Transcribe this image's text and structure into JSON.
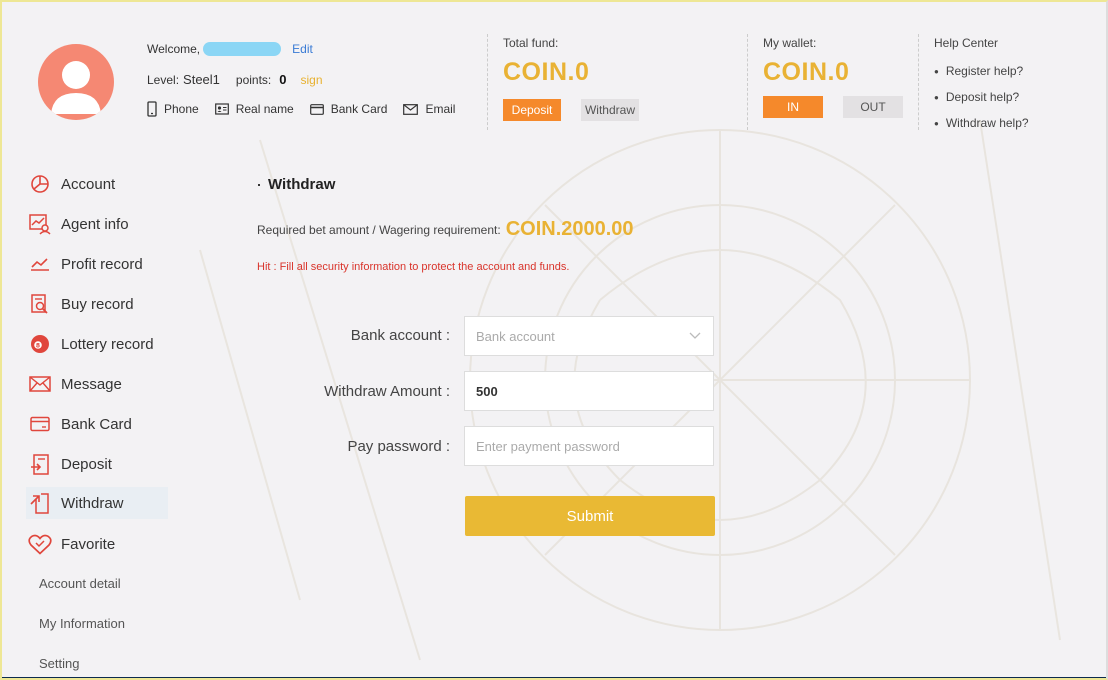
{
  "header": {
    "welcome_label": "Welcome,",
    "edit_label": "Edit",
    "level_label": "Level:",
    "level_value": "Steel1",
    "points_label": "points:",
    "points_value": "0",
    "sign_label": "sign",
    "verify_items": [
      "Phone",
      "Real name",
      "Bank Card",
      "Email"
    ],
    "total_fund_label": "Total fund:",
    "total_fund_value": "COIN.0",
    "deposit_button": "Deposit",
    "withdraw_button": "Withdraw",
    "wallet_label": "My wallet:",
    "wallet_value": "COIN.0",
    "in_button": "IN",
    "out_button": "OUT",
    "help_title": "Help Center",
    "help_items": [
      "Register help?",
      "Deposit help?",
      "Withdraw help?"
    ]
  },
  "sidebar": {
    "items": [
      {
        "label": "Account",
        "icon": "pie-chart-icon"
      },
      {
        "label": "Agent info",
        "icon": "agent-chart-icon"
      },
      {
        "label": "Profit record",
        "icon": "trend-line-icon"
      },
      {
        "label": "Buy record",
        "icon": "document-search-icon"
      },
      {
        "label": "Lottery record",
        "icon": "lottery-ball-icon"
      },
      {
        "label": "Message",
        "icon": "envelope-icon"
      },
      {
        "label": "Bank Card",
        "icon": "bank-card-icon"
      },
      {
        "label": "Deposit",
        "icon": "deposit-icon"
      },
      {
        "label": "Withdraw",
        "icon": "withdraw-icon",
        "active": true
      },
      {
        "label": "Favorite",
        "icon": "heart-icon"
      }
    ],
    "sub_items": [
      "Account detail",
      "My Information",
      "Setting"
    ]
  },
  "main": {
    "title": "Withdraw",
    "requirement_label": "Required bet amount / Wagering requirement:",
    "requirement_value": "COIN.2000.00",
    "hint": "Hit : Fill all security information to protect the account and funds.",
    "bank_account_label": "Bank account :",
    "bank_account_placeholder": "Bank account",
    "amount_label": "Withdraw Amount :",
    "amount_value": "500",
    "password_label": "Pay password :",
    "password_placeholder": "Enter payment password",
    "submit_label": "Submit"
  },
  "colors": {
    "accent_gold": "#e9b234",
    "accent_orange": "#f5892b",
    "avatar": "#f58873",
    "icon_red": "#e0463c",
    "hint_red": "#d9342b"
  }
}
